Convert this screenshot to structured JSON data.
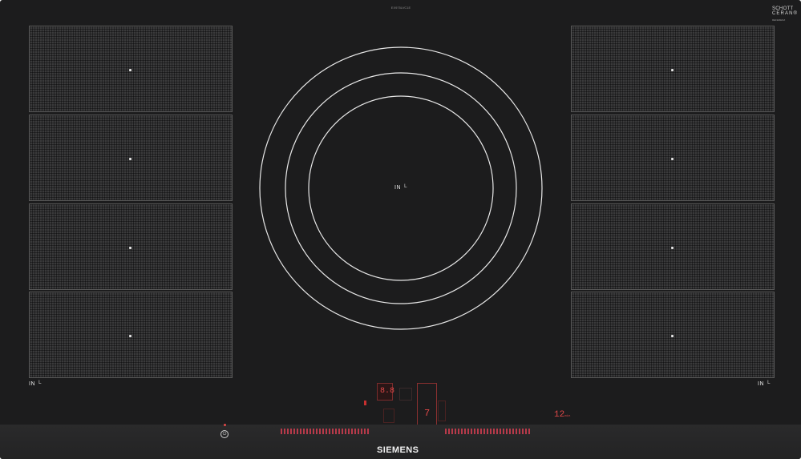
{
  "model_number": "EX975LVC1E",
  "schott_ceran": {
    "line1": "SCHOTT",
    "line2": "CERAN®",
    "line3": "REFERENZ"
  },
  "zones_left": [
    "zone-l1",
    "zone-l2",
    "zone-l3",
    "zone-l4"
  ],
  "zones_right": [
    "zone-r1",
    "zone-r2",
    "zone-r3",
    "zone-r4"
  ],
  "induction_label": "IN",
  "center_label": "IN",
  "brand": "SIEMENS",
  "display": {
    "main_digit": "8.8",
    "timer_digit": "7",
    "right_digit": "12",
    "right_unit": "min"
  },
  "colors": {
    "glass": "#1c1c1d",
    "accent_red": "#e04848",
    "text": "#f0f0f0"
  }
}
